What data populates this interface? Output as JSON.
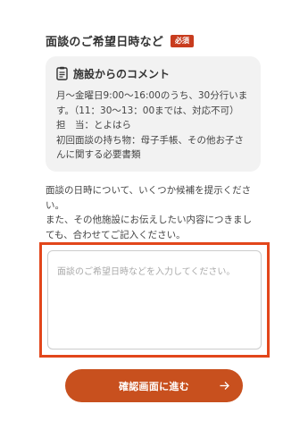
{
  "section": {
    "title": "面談のご希望日時など",
    "required_badge": "必須"
  },
  "comment": {
    "icon": "clipboard-icon",
    "title": "施設からのコメント",
    "lines": [
      "月〜金曜日9:00〜16:00のうち、30分行いま",
      "す。（11：30〜13：00までは、対応不可）",
      "担　当：とよはら",
      "初回面談の持ち物：母子手帳、その他お子さ",
      "んに関する必要書類"
    ]
  },
  "instruction": {
    "lines": [
      "面談の日時について、いくつか候補を提示くださ",
      "い。",
      "また、その他施設にお伝えしたい内容につきまし",
      "ても、合わせてご記入ください。"
    ]
  },
  "textarea": {
    "value": "",
    "placeholder": "面談のご希望日時などを入力してください。"
  },
  "confirm_button": {
    "label": "確認画面に進む",
    "icon": "arrow-right-icon"
  },
  "colors": {
    "accent": "#c8501e",
    "highlight_border": "#e2461b",
    "badge": "#c83c1e",
    "comment_bg": "#f2f2f2"
  }
}
